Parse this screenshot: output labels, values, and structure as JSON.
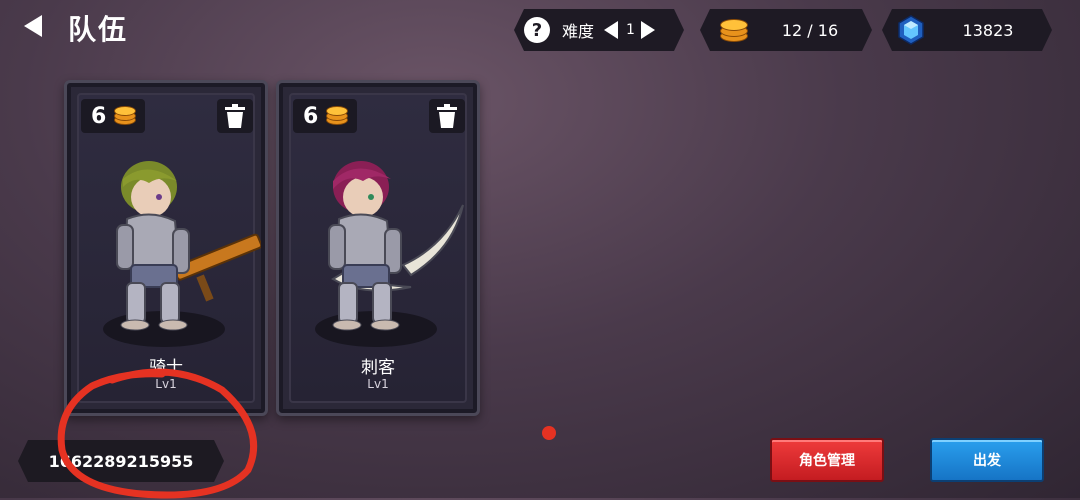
{
  "header": {
    "title": "队伍"
  },
  "difficulty": {
    "label": "难度",
    "value": "1"
  },
  "coins": {
    "text": "12 / 16",
    "color": "#ffc13a"
  },
  "gems": {
    "text": "13823",
    "color": "#3fa9ff"
  },
  "cards": [
    {
      "cost": "6",
      "name": "骑士",
      "level": "Lv1",
      "hair_color": "#7a8a2a"
    },
    {
      "cost": "6",
      "name": "刺客",
      "level": "Lv1",
      "hair_color": "#8a1f55"
    }
  ],
  "player_id": "1662289215955",
  "buttons": {
    "role_manage": "角色管理",
    "depart": "出发"
  },
  "colors": {
    "red_button": "#e1272d",
    "blue_button": "#1e8ce0",
    "annotation": "#e53222"
  }
}
